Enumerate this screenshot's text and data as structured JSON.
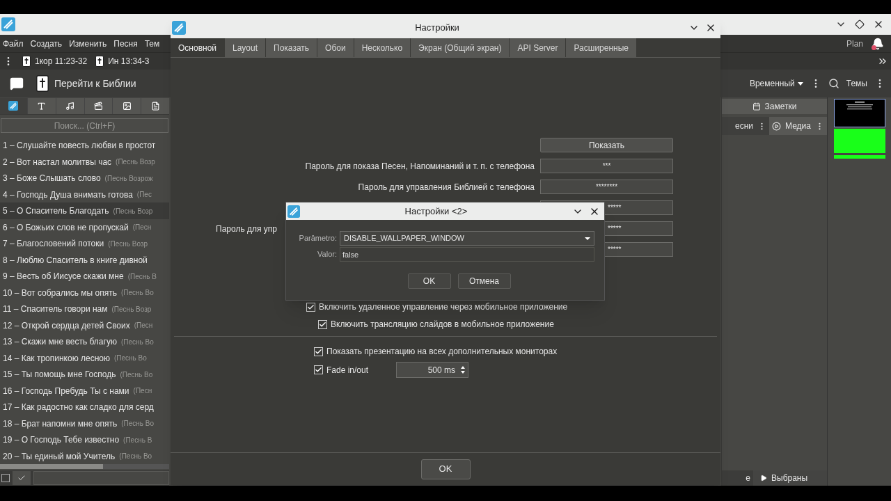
{
  "app": {
    "menu": [
      "Файл",
      "Создать",
      "Изменить",
      "Песня",
      "Тем"
    ],
    "plan": "Plan",
    "notification": true,
    "footer_checkbox": {
      "checked": false
    },
    "toolbar": [
      "1кор 11:23-32",
      "Ин 13:34-3"
    ],
    "bible_button": "Перейти к Библии",
    "search": {
      "placeholder": "Поиск... (Ctrl+F)"
    },
    "songs": [
      {
        "title": "1 – Слушайте повесть любви в простот",
        "selected": false
      },
      {
        "title": "2 – Вот настал молитвы час",
        "source": "(Песнь Возр",
        "selected": false
      },
      {
        "title": "3 – Боже Слышать слово",
        "source": "(Песнь Возрож",
        "selected": false
      },
      {
        "title": "4 – Господь Душа внимать готова",
        "source": "(Пес",
        "selected": false
      },
      {
        "title": "5 – О Спаситель Благодать",
        "source": "(Песнь Возр",
        "selected": true
      },
      {
        "title": "6 – О Божьих слов не пропускай",
        "source": "(Песн",
        "selected": false
      },
      {
        "title": "7 – Благословений потоки",
        "source": "(Песнь Возр",
        "selected": false
      },
      {
        "title": "8 – Люблю Спаситель в книге дивной",
        "selected": false
      },
      {
        "title": "9 – Весть об Иисусе скажи мне",
        "source": "(Песнь В",
        "selected": false
      },
      {
        "title": "10 – Вот собрались мы опять",
        "source": "(Песнь Во",
        "selected": false
      },
      {
        "title": "11 – Спаситель говори нам",
        "source": "(Песнь Возр",
        "selected": false
      },
      {
        "title": "12 – Открой сердца детей Своих",
        "source": "(Песн",
        "selected": false
      },
      {
        "title": "13 – Скажи мне весть благую",
        "source": "(Песнь Во",
        "selected": false
      },
      {
        "title": "14 – Как тропинкою лесною",
        "source": "(Песнь Во",
        "selected": false
      },
      {
        "title": "15 – Ты помощь мне Господь",
        "source": "(Песнь Во",
        "selected": false
      },
      {
        "title": "16 – Господь Пребудь Ты с нами",
        "source": "(Песн",
        "selected": false
      },
      {
        "title": "17 – Как радостно как сладко для серд",
        "selected": false
      },
      {
        "title": "18 – Брат напомни мне опять",
        "source": "(Песнь Во",
        "selected": false
      },
      {
        "title": "19 – О Господь Тебе известно",
        "source": "(Песнь В",
        "selected": false
      },
      {
        "title": "20 – Ты единый мой Учитель",
        "source": "(Песнь Во",
        "selected": false
      }
    ],
    "schedule": "Временный",
    "themes": "Темы",
    "notes_tab": "Заметки",
    "subtabs": [
      {
        "label": "есни",
        "kind": "plain"
      },
      {
        "label": "Медиа",
        "kind": "media"
      }
    ],
    "bottom_tabs": [
      "е",
      "Выбраны"
    ]
  },
  "settings": {
    "title": "Настройки",
    "tabs": [
      {
        "label": "Основной",
        "selected": true
      },
      {
        "label": "Layout",
        "selected": false
      },
      {
        "label": "Показать",
        "selected": false
      },
      {
        "label": "Обои",
        "selected": false
      },
      {
        "label": "Несколько",
        "selected": false
      },
      {
        "label": "Экран (Общий экран)",
        "selected": false
      },
      {
        "label": "API Server",
        "selected": false
      },
      {
        "label": "Расширенные",
        "selected": false
      }
    ],
    "show_button": "Показать",
    "passwords": [
      {
        "label": "Пароль для показа Песен, Напоминаний и т. п. с телефона",
        "value": "***",
        "obscured": false
      },
      {
        "label": "Пароль для управления Библией с телефона",
        "value": "********",
        "obscured": false
      },
      {
        "value": "*****",
        "obscured": true
      },
      {
        "label": "Пароль для упр",
        "value": "*****",
        "obscured": true
      },
      {
        "value": "*****",
        "obscured": true
      }
    ],
    "remote": [
      {
        "label": "Включить удаленное управление через мобильное приложение",
        "checked": true,
        "children": [
          {
            "label": "Включить трансляцию слайдов в мобильное приложение",
            "checked": true
          }
        ]
      }
    ],
    "display": [
      {
        "label": "Показать презентацию на всех дополнительных мониторах",
        "checked": true
      },
      {
        "label": "Fade in/out",
        "checked": true,
        "spinner": "500 ms"
      }
    ],
    "ok": "OK"
  },
  "dialog": {
    "title": "Настройки <2>",
    "param_label": "Parâmetro:",
    "param_value": "DISABLE_WALLPAPER_WINDOW",
    "value_label": "Valor:",
    "value": "false",
    "ok": "OK",
    "cancel": "Отмена"
  }
}
